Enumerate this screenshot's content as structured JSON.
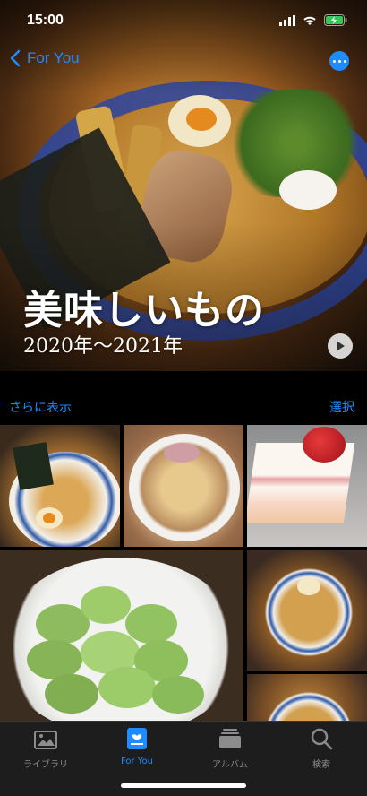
{
  "status_bar": {
    "time": "15:00"
  },
  "nav": {
    "back_label": "For You"
  },
  "hero": {
    "title": "美味しいもの",
    "subtitle": "2020年〜2021年"
  },
  "section": {
    "show_more": "さらに表示",
    "select": "選択"
  },
  "tabs": [
    {
      "label": "ライブラリ",
      "active": false
    },
    {
      "label": "For You",
      "active": true
    },
    {
      "label": "アルバム",
      "active": false
    },
    {
      "label": "検索",
      "active": false
    }
  ],
  "colors": {
    "accent": "#1e8cff",
    "tab_inactive": "#8c8c8c",
    "battery": "#34c759"
  }
}
